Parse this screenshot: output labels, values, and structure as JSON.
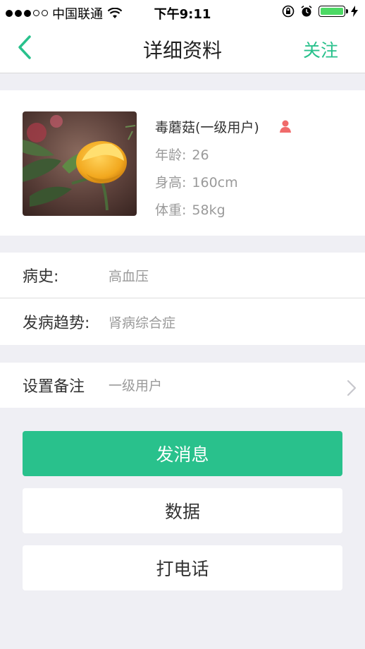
{
  "status_bar": {
    "carrier": "中国联通",
    "time": "下午9:11",
    "signal_bars_filled": 3,
    "signal_bars_total": 5,
    "battery_level": 1.0
  },
  "nav": {
    "title": "详细资料",
    "follow_label": "关注"
  },
  "profile": {
    "name": "毒蘑菇(一级用户)",
    "age_label": "年龄:",
    "age_value": "26",
    "height_label": "身高:",
    "height_value": "160cm",
    "weight_label": "体重:",
    "weight_value": "58kg"
  },
  "medical": {
    "history_label": "病史:",
    "history_value": "高血压",
    "trend_label": "发病趋势:",
    "trend_value": "肾病综合症"
  },
  "remark": {
    "label": "设置备注",
    "value": "一级用户"
  },
  "actions": {
    "message_label": "发消息",
    "data_label": "数据",
    "call_label": "打电话"
  },
  "colors": {
    "accent": "#29c18c",
    "user_icon": "#f06b6b",
    "battery": "#4cd964"
  }
}
